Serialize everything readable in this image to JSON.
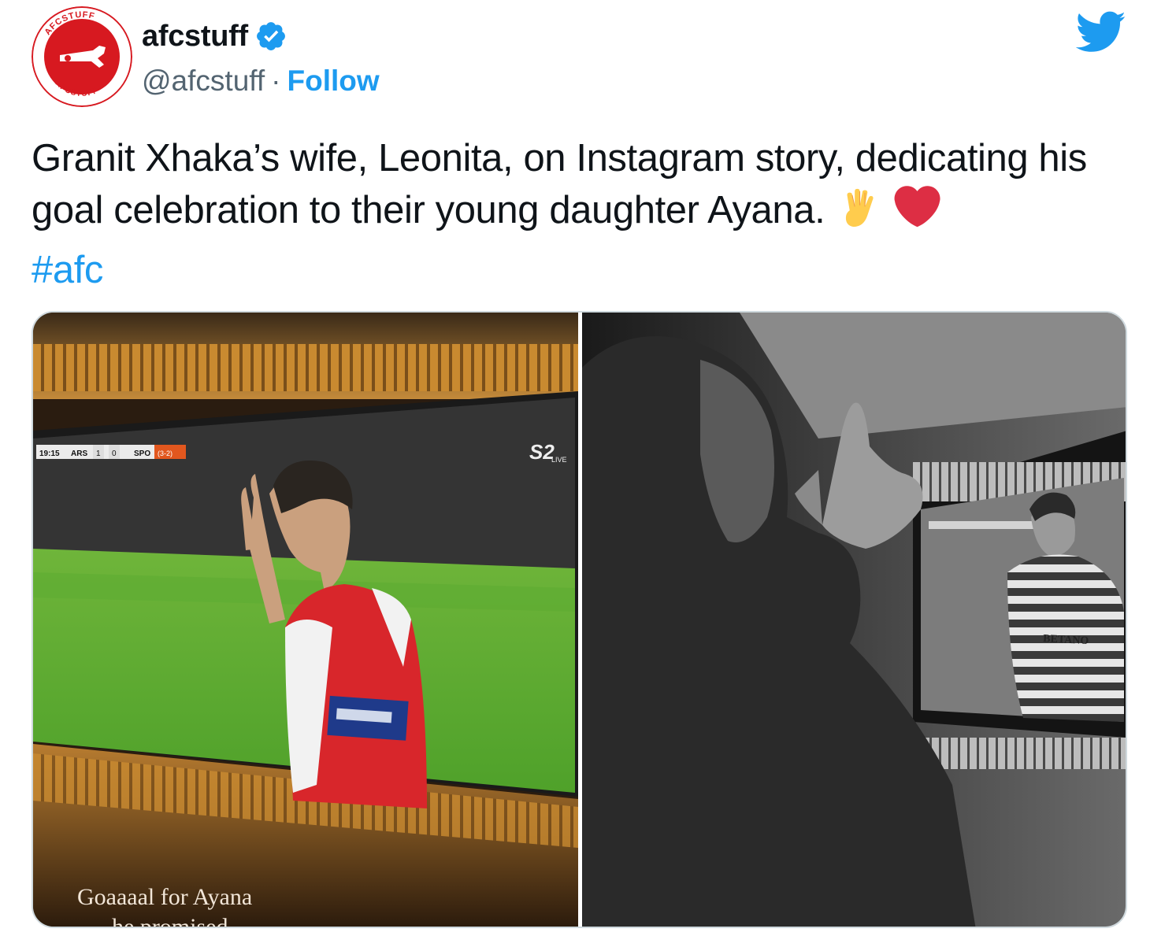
{
  "author": {
    "display_name": "afcstuff",
    "handle": "@afcstuff",
    "separator": "·",
    "follow_label": "Follow",
    "verified": true,
    "avatar_ring_text": "AFCSTUFF"
  },
  "tweet": {
    "text": "Granit Xhaka’s wife, Leonita, on Instagram story, dedicating his goal celebration to their young daughter Ayana.",
    "emojis": [
      "raised-hand-emoji",
      "red-heart-emoji"
    ],
    "hashtag": "#afc"
  },
  "media": {
    "left_photo": {
      "caption_line1": "Goaaaal for Ayana",
      "caption_line2": "he promised",
      "scoreboard": {
        "time": "19:15",
        "home": "ARS",
        "home_score": "1",
        "away_score": "0",
        "away": "SPO",
        "aggregate": "(3-2)"
      },
      "broadcaster": "LIVE"
    },
    "right_photo": {
      "sponsor_text": "BETANO"
    }
  },
  "icons": {
    "platform": "twitter-bird-icon",
    "verified": "verified-badge-icon"
  },
  "colors": {
    "accent": "#1d9bf0",
    "secondary_text": "#536471",
    "avatar_red": "#d71920",
    "heart": "#e0245e"
  }
}
